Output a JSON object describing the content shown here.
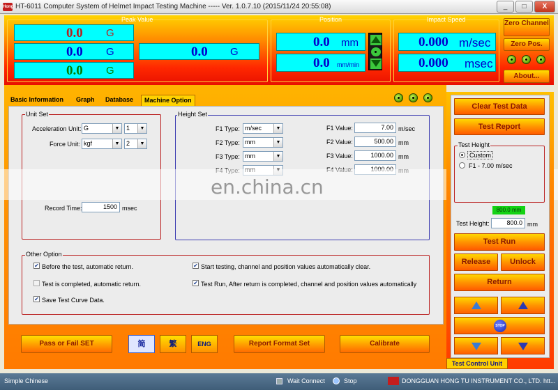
{
  "window": {
    "title": "HT-6011 Computer System of Helmet Impact Testing Machine ----- Ver. 1.0.7.10 (2015/11/24 20:55:08)",
    "icon_text": "Hong",
    "minimize": "_",
    "maximize": "□",
    "close": "X"
  },
  "header": {
    "peak_value": {
      "title": "Peak Value",
      "rows": [
        {
          "value": "0.0",
          "unit": "G",
          "color": "#b22222"
        },
        {
          "value": "0.0",
          "unit": "G",
          "color": "#0000cd"
        },
        {
          "value": "0.0",
          "unit": "G",
          "color": "#008000"
        }
      ],
      "big": {
        "value": "0.0",
        "unit": "G"
      }
    },
    "position": {
      "title": "Position",
      "rows": [
        {
          "value": "0.0",
          "unit": "mm"
        },
        {
          "value": "0.0",
          "unit": "mm/min"
        }
      ]
    },
    "impact_speed": {
      "title": "Impact Speed",
      "rows": [
        {
          "value": "0.000",
          "unit": "m/sec"
        },
        {
          "value": "0.000",
          "unit": "msec"
        }
      ]
    },
    "buttons": {
      "zero_channel": "Zero Channel",
      "zero_pos": "Zero Pos.",
      "about": "About..."
    }
  },
  "tabs": [
    {
      "label": "Basic Information"
    },
    {
      "label": "Graph"
    },
    {
      "label": "Database"
    },
    {
      "label": "Machine Option"
    }
  ],
  "unit_set": {
    "title": "Unit Set",
    "acceleration_label": "Acceleration Unit:",
    "acceleration_value": "G",
    "acceleration_decimals": "1",
    "force_label": "Force Unit:",
    "force_value": "kgf",
    "force_decimals": "2",
    "record_time_label": "Record Time:",
    "record_time_value": "1500",
    "record_time_unit": "msec"
  },
  "height_set": {
    "title": "Height Set",
    "rows": [
      {
        "type_label": "F1 Type:",
        "type_value": "m/sec",
        "value_label": "F1 Value:",
        "value": "7.00",
        "unit": "m/sec"
      },
      {
        "type_label": "F2 Type:",
        "type_value": "mm",
        "value_label": "F2 Value:",
        "value": "500.00",
        "unit": "mm"
      },
      {
        "type_label": "F3 Type:",
        "type_value": "mm",
        "value_label": "F3 Value:",
        "value": "1000.00",
        "unit": "mm"
      },
      {
        "type_label": "F4 Type:",
        "type_value": "mm",
        "value_label": "F4 Value:",
        "value": "1000.00",
        "unit": "mm"
      }
    ]
  },
  "watermark": "en.china.cn",
  "other_option": {
    "title": "Other Option",
    "items": [
      {
        "label": "Before the test, automatic return.",
        "checked": true
      },
      {
        "label": "Test is completed, automatic return.",
        "checked": false
      },
      {
        "label": "Save Test Curve Data.",
        "checked": true
      },
      {
        "label": "Start testing, channel and position values automatically clear.",
        "checked": true
      },
      {
        "label": "Test Run, After return is completed, channel and position values automatically",
        "checked": true
      }
    ]
  },
  "bottom_buttons": {
    "pass_fail": "Pass or Fail SET",
    "simplified": "简",
    "traditional": "繁",
    "english": "ENG",
    "report_format": "Report Format Set",
    "calibrate": "Calibrate"
  },
  "right_panel": {
    "clear_test_data": "Clear Test Data",
    "test_report": "Test Report",
    "test_height_group": "Test Height",
    "radio_custom": "Custom",
    "radio_f1": "F1 - 7.00 m/sec",
    "green_readout": "800.0 mm",
    "test_height_label": "Test Height:",
    "test_height_value": "800.0",
    "test_height_unit": "mm",
    "test_run": "Test Run",
    "release": "Release",
    "unlock": "Unlock",
    "return": "Return",
    "stop": "STOP",
    "tab_label": "Test Control Unit"
  },
  "statusbar": {
    "language": "Simple Chinese",
    "wait_connect": "Wait Connect",
    "stop": "Stop",
    "company": "DONGGUAN HONG TU INSTRUMENT CO., LTD. htt..."
  }
}
